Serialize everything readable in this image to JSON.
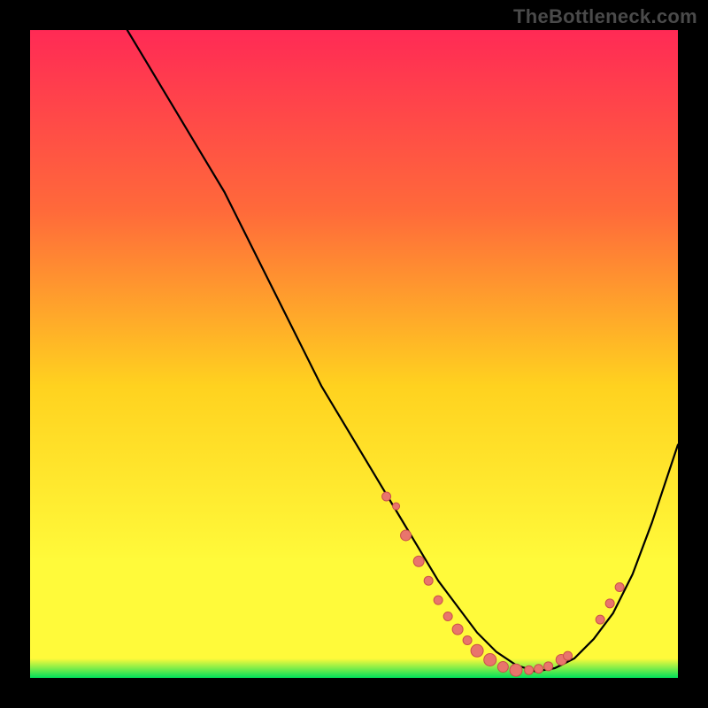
{
  "watermark": "TheBottleneck.com",
  "colors": {
    "gradient_top": "#ff2a55",
    "gradient_mid_upper": "#ff6a3a",
    "gradient_mid": "#ffd21f",
    "gradient_mid_lower": "#fffa3a",
    "gradient_bottom": "#00e05a",
    "curve": "#000000",
    "marker_fill": "#e9756c",
    "marker_stroke": "#c95049"
  },
  "chart_data": {
    "type": "line",
    "title": "",
    "xlabel": "",
    "ylabel": "",
    "xlim": [
      0,
      100
    ],
    "ylim": [
      0,
      100
    ],
    "curve": {
      "x": [
        15,
        18,
        21,
        24,
        27,
        30,
        33,
        36,
        39,
        42,
        45,
        48,
        51,
        54,
        57,
        60,
        63,
        66,
        69,
        72,
        75,
        78,
        81,
        84,
        87,
        90,
        93,
        96,
        100
      ],
      "y": [
        100,
        95,
        90,
        85,
        80,
        75,
        69,
        63,
        57,
        51,
        45,
        40,
        35,
        30,
        25,
        20,
        15,
        11,
        7,
        4,
        2,
        1,
        1.5,
        3,
        6,
        10,
        16,
        24,
        36
      ]
    },
    "markers": [
      {
        "x": 55,
        "y": 28,
        "r": 5
      },
      {
        "x": 56.5,
        "y": 26.5,
        "r": 4
      },
      {
        "x": 58,
        "y": 22,
        "r": 6
      },
      {
        "x": 60,
        "y": 18,
        "r": 6
      },
      {
        "x": 61.5,
        "y": 15,
        "r": 5
      },
      {
        "x": 63,
        "y": 12,
        "r": 5
      },
      {
        "x": 64.5,
        "y": 9.5,
        "r": 5
      },
      {
        "x": 66,
        "y": 7.5,
        "r": 6
      },
      {
        "x": 67.5,
        "y": 5.8,
        "r": 5
      },
      {
        "x": 69,
        "y": 4.2,
        "r": 7
      },
      {
        "x": 71,
        "y": 2.8,
        "r": 7
      },
      {
        "x": 73,
        "y": 1.7,
        "r": 6
      },
      {
        "x": 75,
        "y": 1.2,
        "r": 7
      },
      {
        "x": 77,
        "y": 1.2,
        "r": 5
      },
      {
        "x": 78.5,
        "y": 1.4,
        "r": 5
      },
      {
        "x": 80,
        "y": 1.8,
        "r": 5
      },
      {
        "x": 82,
        "y": 2.8,
        "r": 6
      },
      {
        "x": 83,
        "y": 3.4,
        "r": 5
      },
      {
        "x": 88,
        "y": 9,
        "r": 5
      },
      {
        "x": 89.5,
        "y": 11.5,
        "r": 5
      },
      {
        "x": 91,
        "y": 14,
        "r": 5
      }
    ]
  }
}
